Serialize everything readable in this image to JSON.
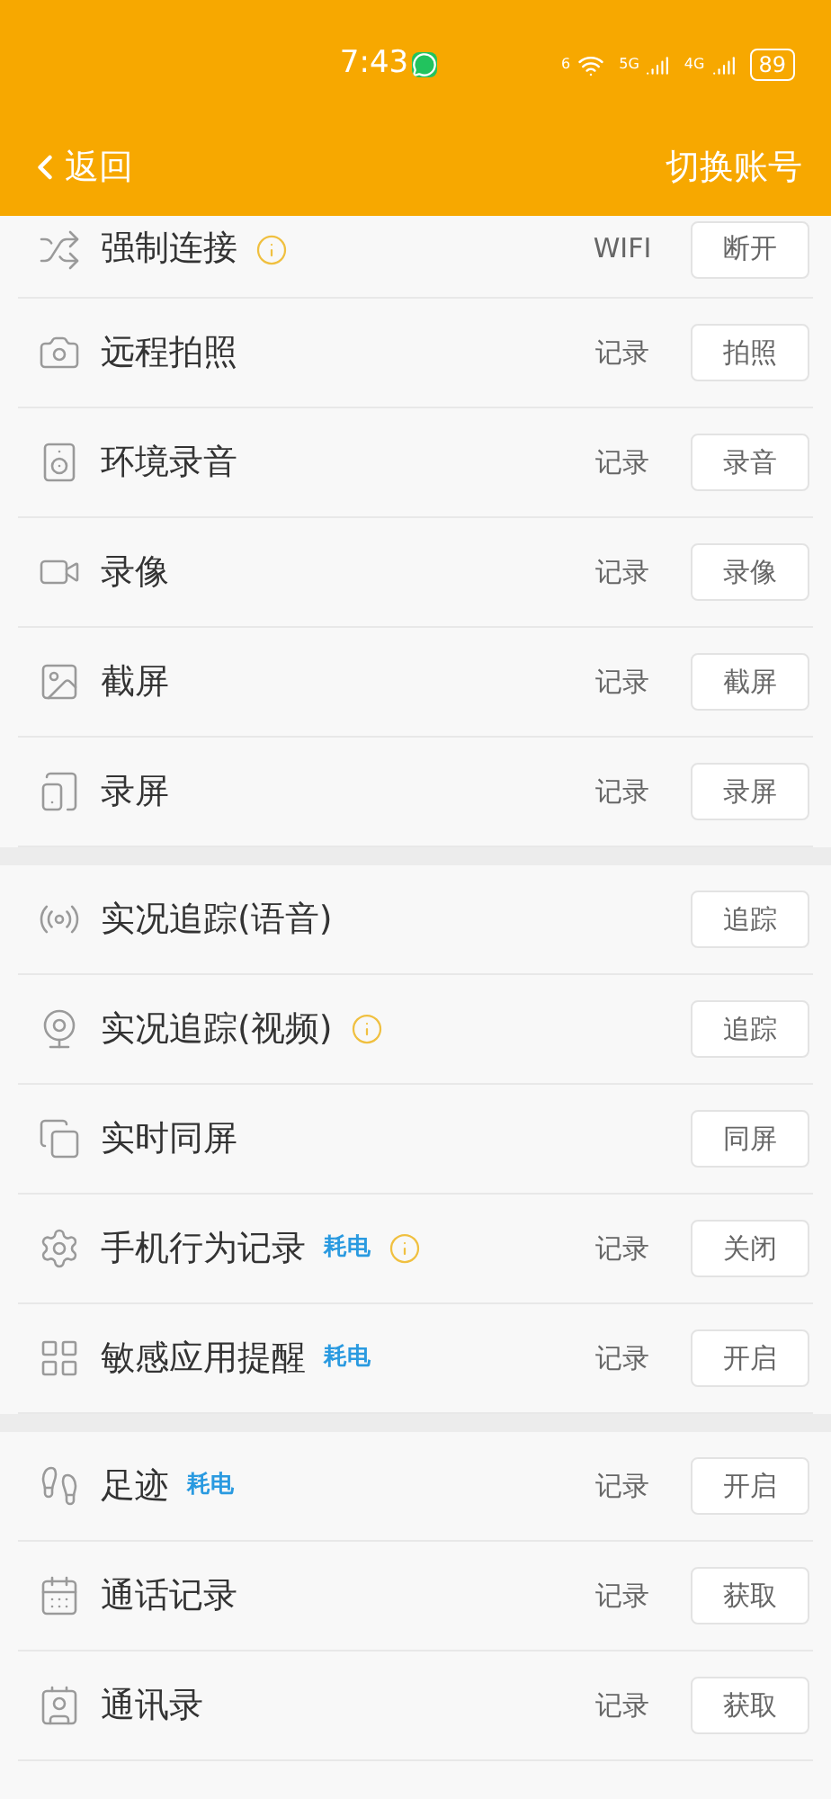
{
  "status_bar": {
    "time": "7:43",
    "wifi_label": "6",
    "signal_1": "5G",
    "signal_2": "4G",
    "battery": "89"
  },
  "nav": {
    "back": "返回",
    "action": "切换账号"
  },
  "sections": [
    [
      {
        "label": "强制连接",
        "info": true,
        "record": "WIFI",
        "button": "断开"
      },
      {
        "label": "远程拍照",
        "info": false,
        "record": "记录",
        "button": "拍照"
      },
      {
        "label": "环境录音",
        "info": false,
        "record": "记录",
        "button": "录音"
      },
      {
        "label": "录像",
        "info": false,
        "record": "记录",
        "button": "录像"
      },
      {
        "label": "截屏",
        "info": false,
        "record": "记录",
        "button": "截屏"
      },
      {
        "label": "录屏",
        "info": false,
        "record": "记录",
        "button": "录屏"
      }
    ],
    [
      {
        "label": "实况追踪(语音)",
        "info": false,
        "button": "追踪"
      },
      {
        "label": "实况追踪(视频)",
        "info": true,
        "button": "追踪"
      },
      {
        "label": "实时同屏",
        "info": false,
        "button": "同屏"
      },
      {
        "label": "手机行为记录",
        "tag": "耗电",
        "info": true,
        "record": "记录",
        "button": "关闭"
      },
      {
        "label": "敏感应用提醒",
        "tag": "耗电",
        "info": false,
        "record": "记录",
        "button": "开启"
      }
    ],
    [
      {
        "label": "足迹",
        "tag": "耗电",
        "info": false,
        "record": "记录",
        "button": "开启"
      },
      {
        "label": "通话记录",
        "info": false,
        "record": "记录",
        "button": "获取"
      },
      {
        "label": "通讯录",
        "info": false,
        "record": "记录",
        "button": "获取"
      }
    ]
  ]
}
